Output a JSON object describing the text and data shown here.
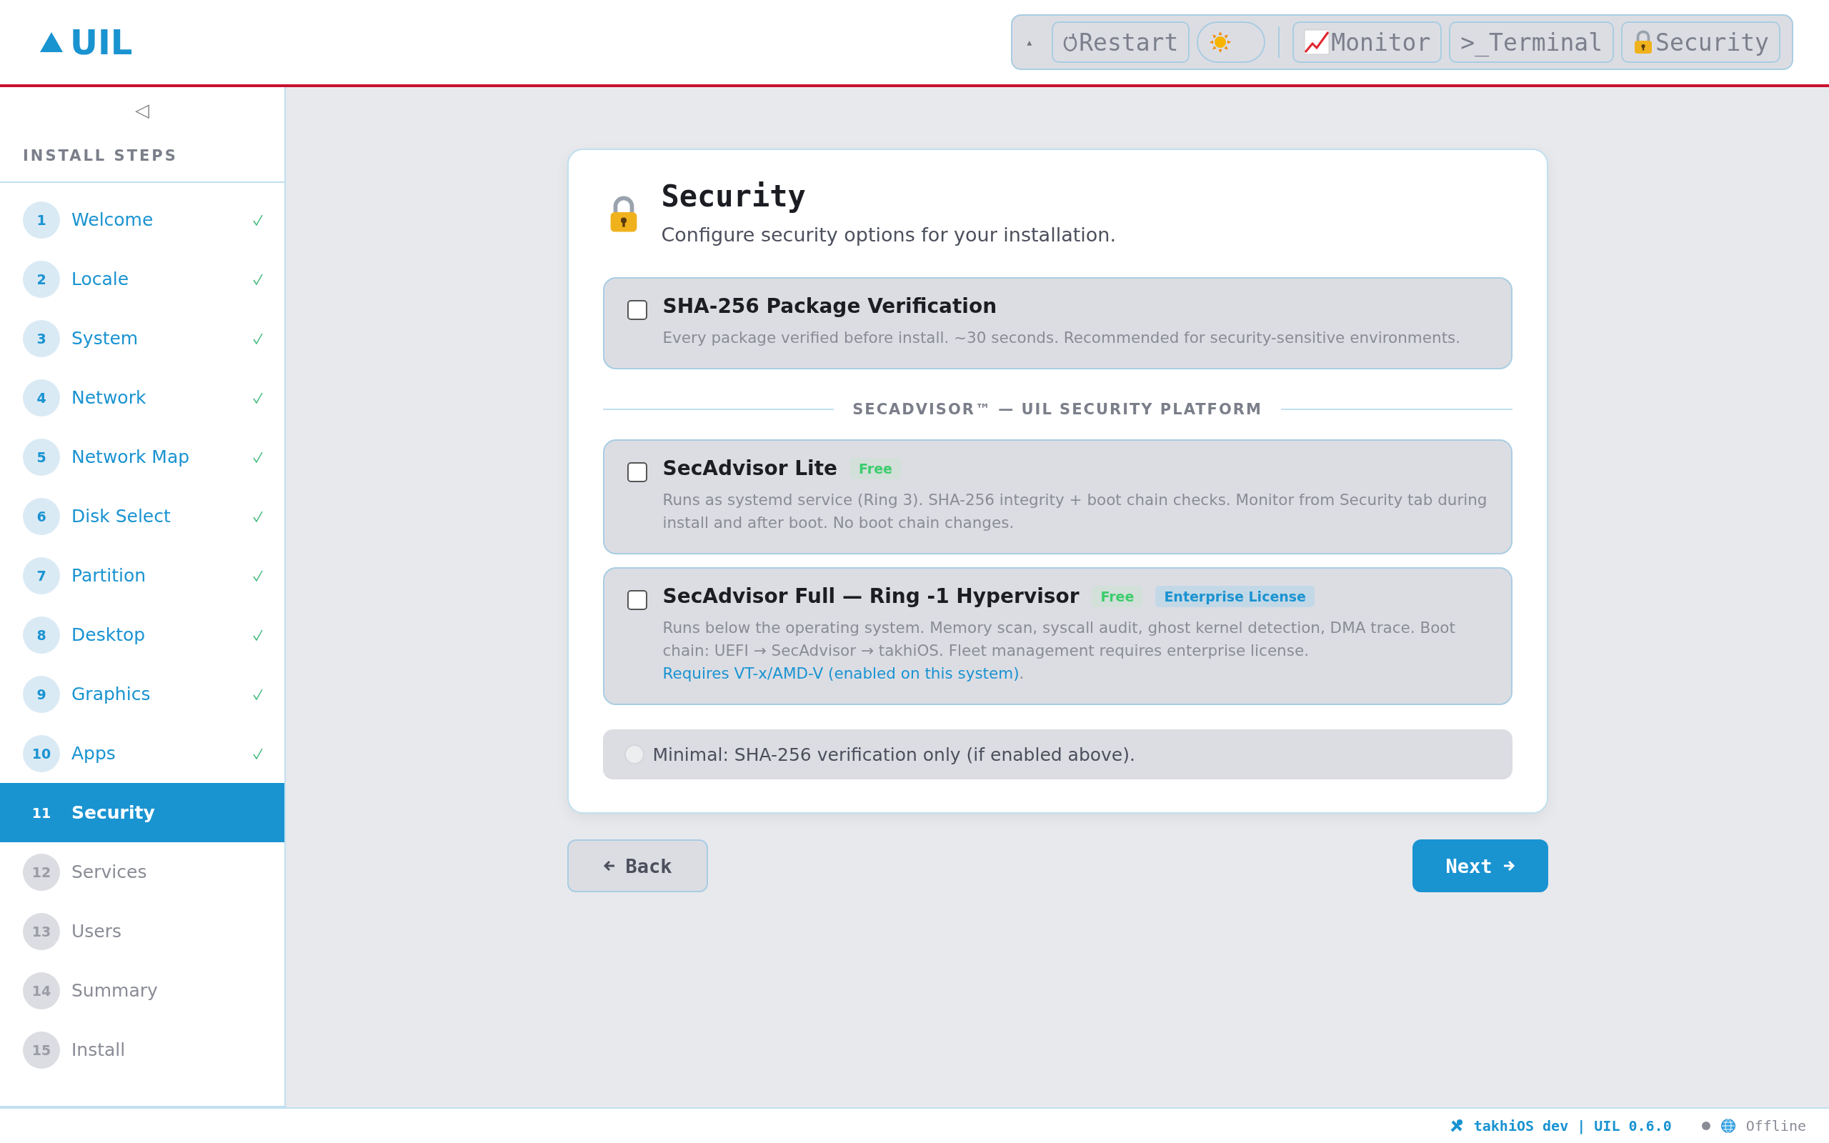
{
  "header": {
    "logo": "UIL",
    "toolbar": {
      "collapse": "▴",
      "buttons": [
        {
          "kind": "restart",
          "label": "Restart"
        },
        {
          "kind": "theme",
          "dark_mode": false
        },
        {
          "kind": "monitor",
          "label": "Monitor"
        },
        {
          "kind": "terminal",
          "label": ">_Terminal"
        },
        {
          "kind": "security",
          "label": "Security"
        }
      ]
    }
  },
  "sidebar": {
    "collapse": "◁",
    "title": "INSTALL STEPS",
    "steps": [
      {
        "number": "1",
        "label": "Welcome",
        "completed": true,
        "selected": false
      },
      {
        "number": "2",
        "label": "Locale",
        "completed": true,
        "selected": false
      },
      {
        "number": "3",
        "label": "System",
        "completed": true,
        "selected": false
      },
      {
        "number": "4",
        "label": "Network",
        "completed": true,
        "selected": false
      },
      {
        "number": "5",
        "label": "Network Map",
        "completed": true,
        "selected": false
      },
      {
        "number": "6",
        "label": "Disk Select",
        "completed": true,
        "selected": false
      },
      {
        "number": "7",
        "label": "Partition",
        "completed": true,
        "selected": false
      },
      {
        "number": "8",
        "label": "Desktop",
        "completed": true,
        "selected": false
      },
      {
        "number": "9",
        "label": "Graphics",
        "completed": true,
        "selected": false
      },
      {
        "number": "10",
        "label": "Apps",
        "completed": true,
        "selected": false
      },
      {
        "number": "11",
        "label": "Security",
        "completed": false,
        "selected": true
      },
      {
        "number": "12",
        "label": "Services",
        "completed": false,
        "selected": false
      },
      {
        "number": "13",
        "label": "Users",
        "completed": false,
        "selected": false
      },
      {
        "number": "14",
        "label": "Summary",
        "completed": false,
        "selected": false
      },
      {
        "number": "15",
        "label": "Install",
        "completed": false,
        "selected": false
      }
    ]
  },
  "card": {
    "title": "Security",
    "subtitle": "Configure security options for your installation.",
    "verification": {
      "title": "SHA-256 Package Verification",
      "checked": false,
      "description": "Every package verified before install. ~30 seconds. Recommended for security-sensitive environments."
    },
    "section_title": "SECADVISOR™ — UIL SECURITY PLATFORM",
    "options": [
      {
        "title": "SecAdvisor Lite",
        "checked": false,
        "badges": [
          {
            "kind": "free",
            "label": "Free"
          }
        ],
        "description": "Runs as systemd service (Ring 3). SHA-256 integrity + boot chain checks. Monitor from Security tab during install and after boot. No boot chain changes."
      },
      {
        "title": "SecAdvisor Full — Ring -1 Hypervisor",
        "checked": false,
        "badges": [
          {
            "kind": "free",
            "label": "Free"
          },
          {
            "kind": "license",
            "label": "Enterprise License"
          }
        ],
        "description": "Runs below the operating system. Memory scan, syscall audit, ghost kernel detection, DMA trace. Boot chain: UEFI → SecAdvisor → takhiOS. Fleet management requires enterprise license.",
        "link": "Requires VT-x/AMD-V (enabled on this system)",
        "link_end": "."
      }
    ],
    "minimal": {
      "label": "Minimal: SHA-256 verification only (if enabled above).",
      "selected": false
    }
  },
  "nav": {
    "back": "Back",
    "next": "Next"
  },
  "status_bar": {
    "build": "takhiOS dev | UIL 0.6.0",
    "network": "Offline"
  }
}
